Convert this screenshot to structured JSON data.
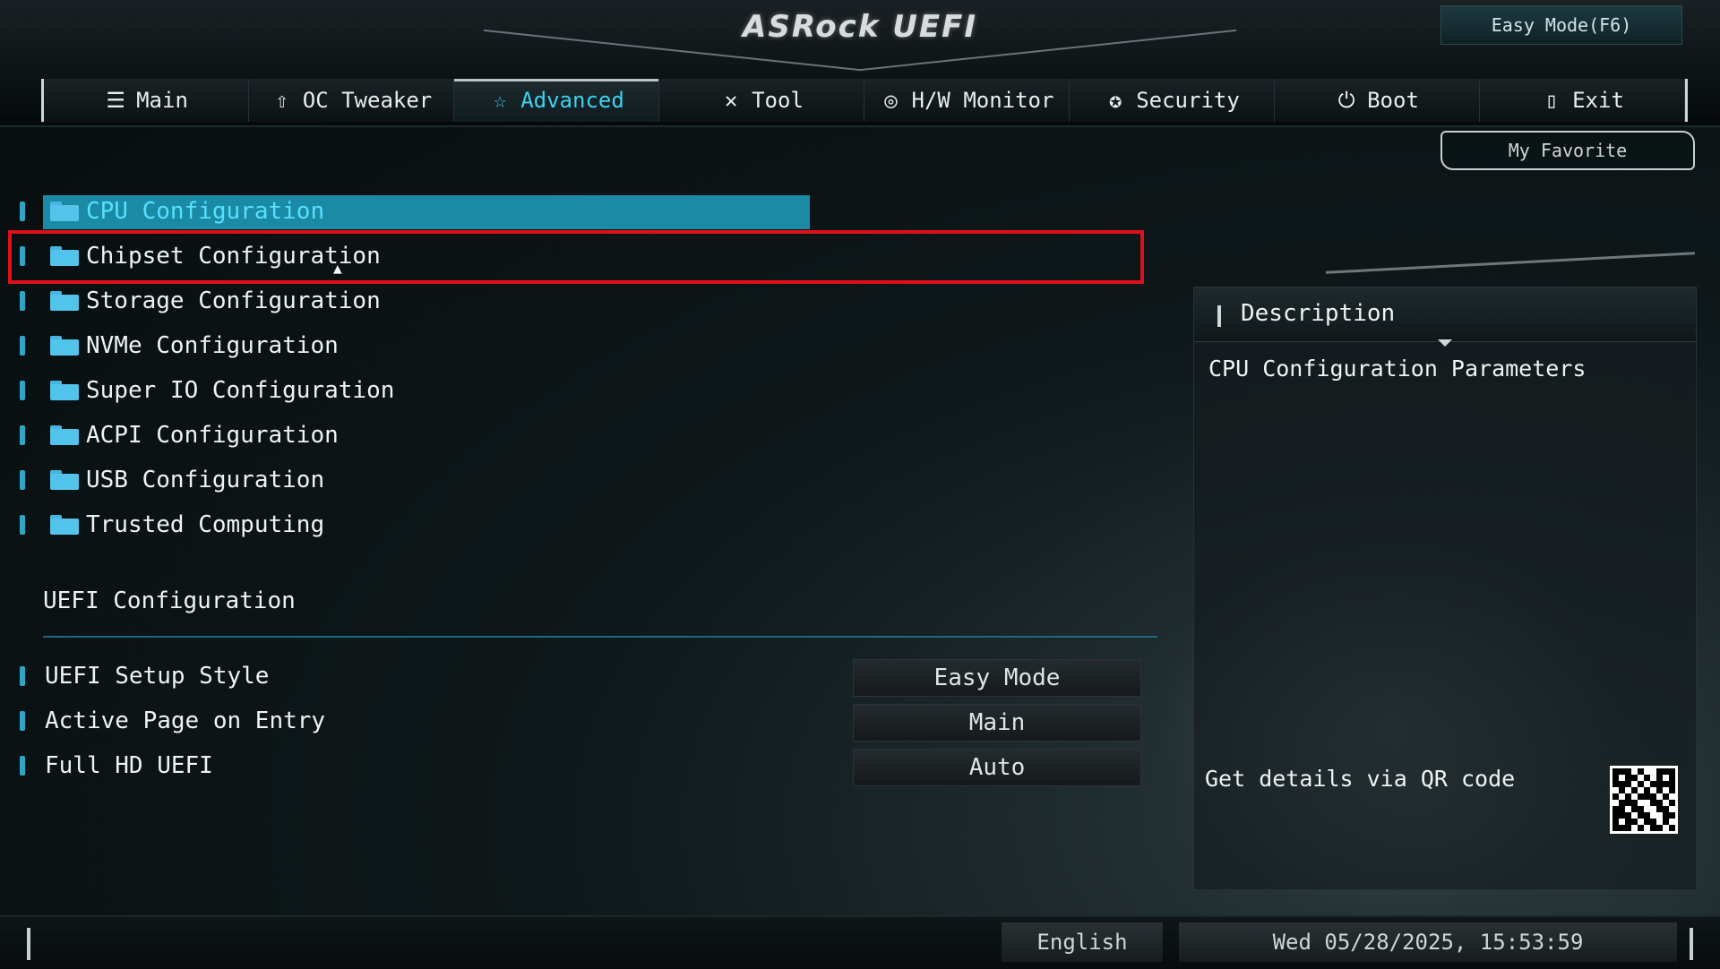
{
  "header": {
    "logo": "ASRock UEFI",
    "easy_mode_button": "Easy Mode(F6)",
    "my_favorite": "My Favorite"
  },
  "tabs": [
    {
      "label": "Main",
      "icon": "list-icon"
    },
    {
      "label": "OC Tweaker",
      "icon": "rocket-icon"
    },
    {
      "label": "Advanced",
      "icon": "star-icon",
      "active": true
    },
    {
      "label": "Tool",
      "icon": "tools-icon"
    },
    {
      "label": "H/W Monitor",
      "icon": "monitor-gauge-icon"
    },
    {
      "label": "Security",
      "icon": "shield-icon"
    },
    {
      "label": "Boot",
      "icon": "power-icon"
    },
    {
      "label": "Exit",
      "icon": "exit-door-icon"
    }
  ],
  "menu": {
    "items": [
      {
        "label": "CPU Configuration",
        "selected": true
      },
      {
        "label": "Chipset Configuration"
      },
      {
        "label": "Storage Configuration"
      },
      {
        "label": "NVMe Configuration"
      },
      {
        "label": "Super IO Configuration"
      },
      {
        "label": "ACPI Configuration"
      },
      {
        "label": "USB Configuration"
      },
      {
        "label": "Trusted Computing"
      }
    ],
    "section_title": "UEFI Configuration",
    "options": [
      {
        "label": "UEFI Setup Style",
        "value": "Easy Mode"
      },
      {
        "label": "Active Page on Entry",
        "value": "Main"
      },
      {
        "label": "Full HD UEFI",
        "value": "Auto"
      }
    ]
  },
  "description": {
    "title": "Description",
    "text": "CPU Configuration Parameters",
    "qr_label": "Get details via QR code"
  },
  "footer": {
    "language": "English",
    "datetime": "Wed 05/28/2025, 15:53:59"
  },
  "colors": {
    "accent": "#3fd1ef",
    "selected_bg": "#1a8aa5",
    "focus_border": "#e0101a"
  }
}
